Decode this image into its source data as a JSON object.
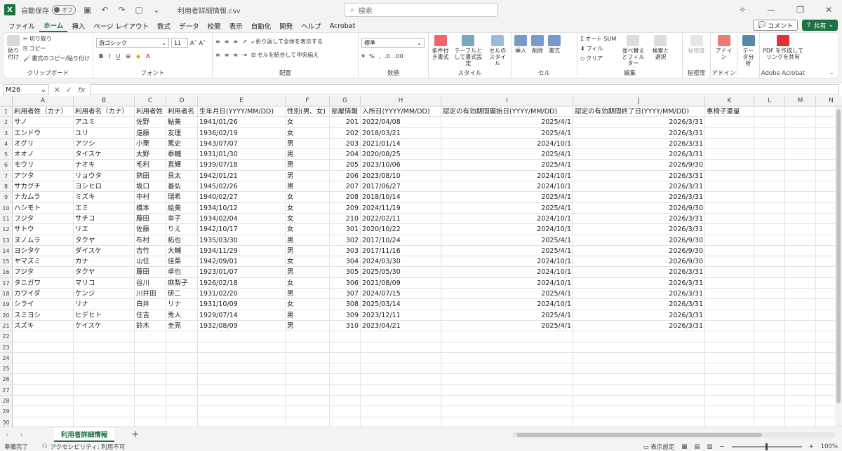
{
  "titlebar": {
    "autosave_label": "自動保存",
    "autosave_state": "オフ",
    "filename": "利用者詳細情報.csv",
    "search_placeholder": "検索"
  },
  "menu": {
    "tabs": [
      "ファイル",
      "ホーム",
      "挿入",
      "ページ レイアウト",
      "数式",
      "データ",
      "校閲",
      "表示",
      "自動化",
      "開発",
      "ヘルプ",
      "Acrobat"
    ],
    "active": "ホーム",
    "comment_label": "コメント",
    "share_label": "共有"
  },
  "ribbon": {
    "clipboard": {
      "paste": "貼り付け",
      "cut": "切り取り",
      "copy": "コピー",
      "format_painter": "書式のコピー/貼り付け",
      "label": "クリップボード"
    },
    "font": {
      "name": "游ゴシック",
      "size": "11",
      "label": "フォント",
      "bold": "B",
      "italic": "I",
      "underline": "U"
    },
    "alignment": {
      "wrap": "折り返して全体を表示する",
      "merge": "セルを結合して中央揃え",
      "label": "配置"
    },
    "number": {
      "format": "標準",
      "label": "数値"
    },
    "style": {
      "conditional": "条件付き書式",
      "table": "テーブルとして書式設定",
      "cell": "セルのスタイル",
      "label": "スタイル"
    },
    "cells": {
      "insert": "挿入",
      "delete": "削除",
      "format": "書式",
      "label": "セル"
    },
    "editing": {
      "autosum": "オート SUM",
      "fill": "フィル",
      "clear": "クリア",
      "sort": "並べ替えとフィルター",
      "find": "検索と選択",
      "label": "編集"
    },
    "sensitivity": {
      "btn": "秘密度",
      "label": "秘密度"
    },
    "addin": {
      "btn": "アドイン",
      "label": "アドイン"
    },
    "analysis": {
      "btn": "データ分析"
    },
    "acrobat": {
      "btn": "PDF を作成してリンクを共有",
      "label": "Adobe Acrobat"
    }
  },
  "formula": {
    "namebox": "M26",
    "fx": "fx"
  },
  "columns": [
    "A",
    "B",
    "C",
    "D",
    "E",
    "F",
    "G",
    "H",
    "I",
    "J",
    "K",
    "L",
    "M",
    "N"
  ],
  "rows": [
    [
      "利用者姓（カナ）",
      "利用者名（カナ）",
      "利用者姓",
      "利用者名",
      "生年月日(YYYY/MM/DD)",
      "性別(男、女)",
      "部屋情報",
      "入所日(YYYY/MM/DD)",
      "認定の有効期間開始日(YYYY/MM/DD)",
      "認定の有効期間終了日(YYYY/MM/DD)",
      "車椅子重量",
      "",
      "",
      ""
    ],
    [
      "サノ",
      "アユミ",
      "佐野",
      "鮎美",
      "1941/01/26",
      "女",
      "201",
      "2022/04/08",
      "2025/4/1",
      "2026/3/31",
      "",
      "",
      "",
      ""
    ],
    [
      "エンドウ",
      "ユリ",
      "遠藤",
      "友理",
      "1936/02/19",
      "女",
      "202",
      "2018/03/21",
      "2025/4/1",
      "2026/3/31",
      "",
      "",
      "",
      ""
    ],
    [
      "オグリ",
      "アツシ",
      "小栗",
      "篤史",
      "1943/07/07",
      "男",
      "203",
      "2021/01/14",
      "2024/10/1",
      "2026/3/31",
      "",
      "",
      "",
      ""
    ],
    [
      "オオノ",
      "タイスケ",
      "大野",
      "泰輔",
      "1931/01/30",
      "男",
      "204",
      "2020/08/25",
      "2025/4/1",
      "2026/3/31",
      "",
      "",
      "",
      ""
    ],
    [
      "モウリ",
      "ナオキ",
      "毛利",
      "直輝",
      "1939/07/18",
      "男",
      "205",
      "2023/10/06",
      "2025/4/1",
      "2026/9/30",
      "",
      "",
      "",
      ""
    ],
    [
      "アツタ",
      "リョウタ",
      "熱田",
      "良太",
      "1942/01/21",
      "男",
      "206",
      "2023/08/10",
      "2024/10/1",
      "2026/3/31",
      "",
      "",
      "",
      ""
    ],
    [
      "サカグチ",
      "ヨシヒロ",
      "坂口",
      "善弘",
      "1945/02/26",
      "男",
      "207",
      "2017/06/27",
      "2024/10/1",
      "2026/3/31",
      "",
      "",
      "",
      ""
    ],
    [
      "ナカムラ",
      "ミズキ",
      "中村",
      "瑞希",
      "1940/02/27",
      "女",
      "208",
      "2018/10/14",
      "2025/4/1",
      "2026/3/31",
      "",
      "",
      "",
      ""
    ],
    [
      "ハシモト",
      "エミ",
      "橋本",
      "絵美",
      "1934/10/12",
      "女",
      "209",
      "2024/11/19",
      "2025/4/1",
      "2026/9/30",
      "",
      "",
      "",
      ""
    ],
    [
      "フジタ",
      "サチコ",
      "藤田",
      "幸子",
      "1934/02/04",
      "女",
      "210",
      "2022/02/11",
      "2024/10/1",
      "2026/3/31",
      "",
      "",
      "",
      ""
    ],
    [
      "サトウ",
      "リエ",
      "佐藤",
      "りえ",
      "1942/10/17",
      "女",
      "301",
      "2020/10/22",
      "2024/10/1",
      "2026/3/31",
      "",
      "",
      "",
      ""
    ],
    [
      "ヌノムラ",
      "タクヤ",
      "布村",
      "拓也",
      "1935/03/30",
      "男",
      "302",
      "2017/10/24",
      "2025/4/1",
      "2026/9/30",
      "",
      "",
      "",
      ""
    ],
    [
      "ヨシタケ",
      "ダイスケ",
      "吉竹",
      "大輔",
      "1934/11/29",
      "男",
      "303",
      "2017/11/16",
      "2025/4/1",
      "2026/9/30",
      "",
      "",
      "",
      ""
    ],
    [
      "ヤマズミ",
      "カナ",
      "山住",
      "佳菜",
      "1942/09/01",
      "女",
      "304",
      "2024/03/30",
      "2024/10/1",
      "2026/9/30",
      "",
      "",
      "",
      ""
    ],
    [
      "フジタ",
      "タクヤ",
      "藤田",
      "卓也",
      "1923/01/07",
      "男",
      "305",
      "2025/05/30",
      "2024/10/1",
      "2026/3/31",
      "",
      "",
      "",
      ""
    ],
    [
      "タニガワ",
      "マリコ",
      "谷川",
      "麻梨子",
      "1926/02/18",
      "女",
      "306",
      "2021/08/09",
      "2024/10/1",
      "2026/3/31",
      "",
      "",
      "",
      ""
    ],
    [
      "カワイダ",
      "ケンジ",
      "川井田",
      "研二",
      "1931/02/20",
      "男",
      "307",
      "2024/07/15",
      "2025/4/1",
      "2026/3/31",
      "",
      "",
      "",
      ""
    ],
    [
      "シライ",
      "リナ",
      "白井",
      "リナ",
      "1931/10/09",
      "女",
      "308",
      "2025/03/14",
      "2024/10/1",
      "2026/3/31",
      "",
      "",
      "",
      ""
    ],
    [
      "スミヨシ",
      "ヒデヒト",
      "住吉",
      "秀人",
      "1929/07/14",
      "男",
      "309",
      "2023/12/11",
      "2025/4/1",
      "2026/3/31",
      "",
      "",
      "",
      ""
    ],
    [
      "スズキ",
      "ケイスケ",
      "鈴木",
      "圭亮",
      "1932/08/09",
      "男",
      "310",
      "2023/04/21",
      "2025/4/1",
      "2026/3/31",
      "",
      "",
      "",
      ""
    ]
  ],
  "sheet": {
    "tab": "利用者詳細情報",
    "add": "+"
  },
  "status": {
    "ready": "準備完了",
    "accessibility": "アクセシビリティ: 利用不可",
    "display_settings": "表示設定",
    "zoom": "100%"
  }
}
